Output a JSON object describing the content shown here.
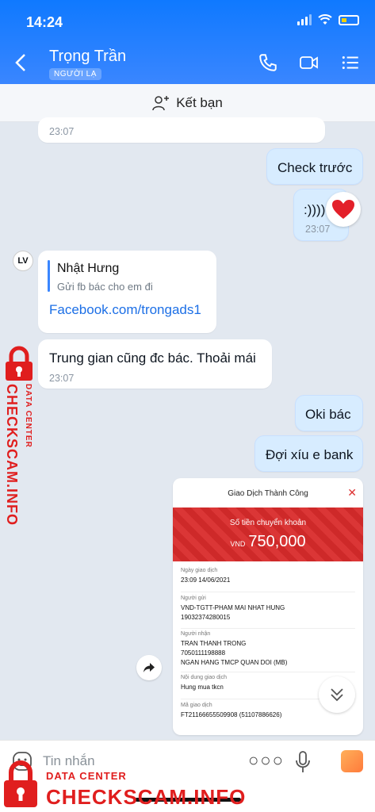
{
  "status": {
    "time": "14:24"
  },
  "header": {
    "contact_name": "Trọng Trần",
    "badge": "NGƯỜI LẠ"
  },
  "friend_bar": {
    "label": "Kết bạn"
  },
  "messages": {
    "top_ts": "23:07",
    "check_truoc": "Check trước",
    "smile_text": ":))))",
    "smile_ts": "23:07",
    "reply_name": "Nhật Hưng",
    "reply_quote": "Gửi fb bác cho em đi",
    "link": "Facebook.com/trongads1",
    "trung_gian": "Trung gian cũng đc bác. Thoải mái",
    "trung_gian_ts": "23:07",
    "oki": "Oki bác",
    "doi_xiu": "Đợi xíu e bank"
  },
  "receipt": {
    "title": "Giao Dịch Thành Công",
    "amount_label": "Số tiền chuyển khoản",
    "currency": "VND",
    "amount": "750,000",
    "date_label": "Ngày giao dịch",
    "date_value": "23:09 14/06/2021",
    "sender_label": "Người gửi",
    "sender_name": "VND-TGTT-PHAM MAI NHAT HUNG",
    "sender_acct": "19032374280015",
    "receiver_label": "Người nhận",
    "receiver_name": "TRAN THANH TRONG",
    "receiver_acct": "7050111198888",
    "receiver_bank": "NGAN HANG TMCP QUAN DOI (MB)",
    "content_label": "Nội dung giao dịch",
    "content_value": "Hung mua tkcn",
    "txid_label": "Mã giao dịch",
    "txid_value": "FT21166655509908 (51107886626)"
  },
  "input": {
    "placeholder": "Tin nhắn",
    "more": "○○○"
  },
  "watermark": {
    "small": "DATA CENTER",
    "big": "CHECKSCAM.INFO"
  },
  "colors": {
    "header": "#1a7dff",
    "sent_bubble": "#d7ecff",
    "receipt_red": "#d92b2b",
    "watermark": "#e01e1e"
  }
}
